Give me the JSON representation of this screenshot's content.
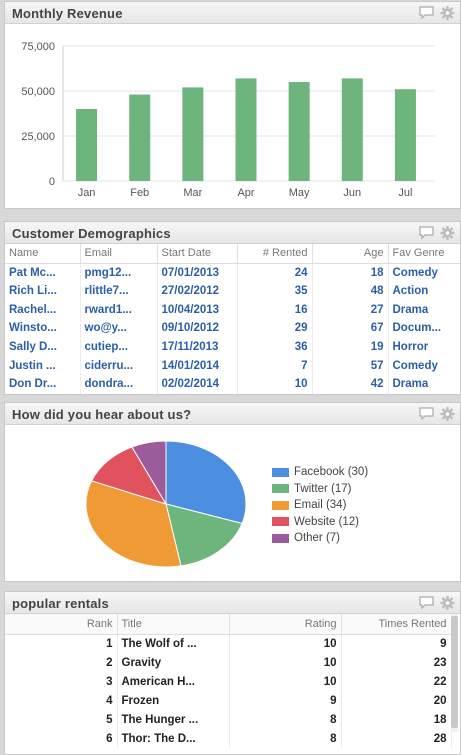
{
  "revenue": {
    "title": "Monthly Revenue",
    "chart_data": {
      "type": "bar",
      "categories": [
        "Jan",
        "Feb",
        "Mar",
        "Apr",
        "May",
        "Jun",
        "Jul"
      ],
      "values": [
        40000,
        48000,
        52000,
        57000,
        55000,
        57000,
        51000
      ],
      "ylim": [
        0,
        75000
      ],
      "yticks": [
        "75,000",
        "50,000",
        "25,000",
        "0"
      ],
      "ytick_values": [
        75000,
        50000,
        25000,
        0
      ],
      "bar_color": "#6db47d",
      "grid": true
    }
  },
  "demographics": {
    "title": "Customer Demographics",
    "columns": [
      "Name",
      "Email",
      "Start Date",
      "# Rented",
      "Age",
      "Fav Genre"
    ],
    "rows": [
      [
        "Pat Mc...",
        "pmg12...",
        "07/01/2013",
        "24",
        "18",
        "Comedy"
      ],
      [
        "Rich Li...",
        "rlittle7...",
        "27/02/2012",
        "35",
        "48",
        "Action"
      ],
      [
        "Rachel...",
        "rward1...",
        "10/04/2013",
        "16",
        "27",
        "Drama"
      ],
      [
        "Winsto...",
        "wo@y...",
        "09/10/2012",
        "29",
        "67",
        "Docum..."
      ],
      [
        "Sally D...",
        "cutiep...",
        "17/11/2013",
        "36",
        "19",
        "Horror"
      ],
      [
        "Justin ...",
        "ciderru...",
        "14/01/2014",
        "7",
        "57",
        "Comedy"
      ],
      [
        "Don Dr...",
        "dondra...",
        "02/02/2014",
        "10",
        "42",
        "Drama"
      ]
    ]
  },
  "hear": {
    "title": "How did you hear about us?",
    "chart_data": {
      "type": "pie",
      "series": [
        {
          "name": "Facebook",
          "label": "Facebook (30)",
          "value": 30,
          "color": "#4c8fe0"
        },
        {
          "name": "Twitter",
          "label": "Twitter (17)",
          "value": 17,
          "color": "#6db47d"
        },
        {
          "name": "Email",
          "label": "Email (34)",
          "value": 34,
          "color": "#ef9a35"
        },
        {
          "name": "Website",
          "label": "Website (12)",
          "value": 12,
          "color": "#e0525e"
        },
        {
          "name": "Other",
          "label": "Other (7)",
          "value": 7,
          "color": "#9b5c9c"
        }
      ],
      "legend": "right"
    }
  },
  "rentals": {
    "title": "popular rentals",
    "columns": [
      "Rank",
      "Title",
      "Rating",
      "Times Rented"
    ],
    "rows": [
      [
        "1",
        "The Wolf of ...",
        "10",
        "9"
      ],
      [
        "2",
        "Gravity",
        "10",
        "23"
      ],
      [
        "3",
        "American H...",
        "10",
        "22"
      ],
      [
        "4",
        "Frozen",
        "9",
        "20"
      ],
      [
        "5",
        "The Hunger ...",
        "8",
        "18"
      ],
      [
        "6",
        "Thor: The D...",
        "8",
        "28"
      ]
    ]
  },
  "icons": {
    "comment": "comment-icon",
    "settings": "gear-icon"
  }
}
